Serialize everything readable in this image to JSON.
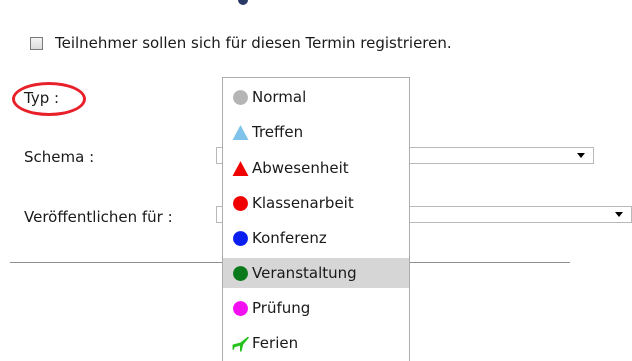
{
  "register": {
    "checked": false,
    "label": "Teilnehmer sollen sich für diesen Termin registrieren."
  },
  "form": {
    "typ_label": "Typ :",
    "schema_label": "Schema :",
    "publish_label": "Veröffentlichen für :",
    "schema_value": "",
    "publish_value": ""
  },
  "dropdown": {
    "selected": "Veranstaltung",
    "options": [
      {
        "label": "Normal",
        "icon": "gray-circle-icon",
        "color": "#b5b5b5"
      },
      {
        "label": "Treffen",
        "icon": "light-blue-triangle-icon",
        "color": "#7fc3ea"
      },
      {
        "label": "Abwesenheit",
        "icon": "red-triangle-icon",
        "color": "#f00000"
      },
      {
        "label": "Klassenarbeit",
        "icon": "red-circle-icon",
        "color": "#f00000"
      },
      {
        "label": "Konferenz",
        "icon": "blue-circle-icon",
        "color": "#0a1ff0"
      },
      {
        "label": "Veranstaltung",
        "icon": "dark-green-circle-icon",
        "color": "#0b7a1b"
      },
      {
        "label": "Prüfung",
        "icon": "magenta-circle-icon",
        "color": "#f20ff0"
      },
      {
        "label": "Ferien",
        "icon": "green-airplane-icon",
        "color": "#27c21d"
      }
    ]
  },
  "colors": {
    "highlight": "#e8202a",
    "selected_row": "#d6d6d6",
    "border": "#adadad"
  }
}
